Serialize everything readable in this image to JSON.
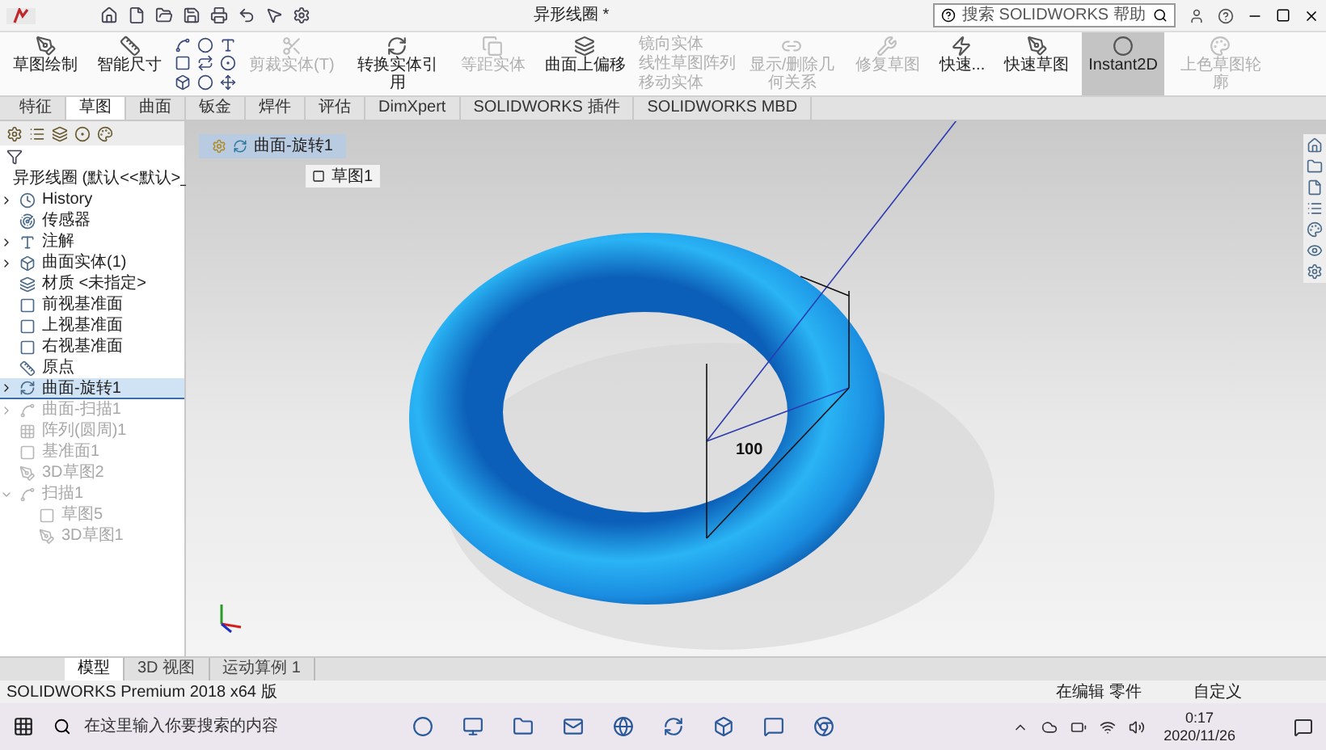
{
  "window": {
    "title": "异形线圈 *",
    "search": {
      "placeholder": "搜索 SOLIDWORKS 帮助"
    }
  },
  "ribbon": [
    {
      "kind": "large",
      "label": "草图绘制",
      "selected": false,
      "disabled": false
    },
    {
      "kind": "large",
      "label": "智能尺寸",
      "selected": false,
      "disabled": false
    },
    {
      "kind": "tools"
    },
    {
      "kind": "large",
      "label": "剪裁实体(T)",
      "selected": false,
      "disabled": true
    },
    {
      "kind": "large",
      "label": "转换实体引用",
      "selected": false,
      "disabled": false
    },
    {
      "kind": "large",
      "label": "等距实体",
      "selected": false,
      "disabled": true
    },
    {
      "kind": "large",
      "label": "曲面上偏移",
      "selected": false,
      "disabled": false
    },
    {
      "kind": "list",
      "items": [
        {
          "label": "镜向实体",
          "disabled": true
        },
        {
          "label": "线性草图阵列",
          "disabled": true
        },
        {
          "label": "移动实体",
          "disabled": true
        }
      ]
    },
    {
      "kind": "large",
      "label": "显示/删除几何关系",
      "selected": false,
      "disabled": true
    },
    {
      "kind": "large",
      "label": "修复草图",
      "selected": false,
      "disabled": true
    },
    {
      "kind": "large",
      "label": "快速...",
      "selected": false,
      "disabled": false
    },
    {
      "kind": "large",
      "label": "快速草图",
      "selected": false,
      "disabled": false
    },
    {
      "kind": "large",
      "label": "Instant2D",
      "selected": true,
      "disabled": false
    },
    {
      "kind": "large",
      "label": "上色草图轮廓",
      "selected": false,
      "disabled": true
    }
  ],
  "tabs": [
    {
      "label": "特征",
      "selected": false
    },
    {
      "label": "草图",
      "selected": true
    },
    {
      "label": "曲面",
      "selected": false
    },
    {
      "label": "钣金",
      "selected": false
    },
    {
      "label": "焊件",
      "selected": false
    },
    {
      "label": "评估",
      "selected": false
    },
    {
      "label": "DimXpert",
      "selected": false
    },
    {
      "label": "SOLIDWORKS 插件",
      "selected": false
    },
    {
      "label": "SOLIDWORKS MBD",
      "selected": false
    }
  ],
  "tree": {
    "root": "异形线圈 (默认<<默认>_",
    "items": [
      {
        "kind": "history",
        "label": "History",
        "expanded": false,
        "selected": false,
        "disabled": false
      },
      {
        "kind": "sensor",
        "label": "传感器",
        "selected": false,
        "disabled": false
      },
      {
        "kind": "annotation",
        "label": "注解",
        "expanded": false,
        "selected": false,
        "disabled": false
      },
      {
        "kind": "body",
        "label": "曲面实体(1)",
        "expanded": false,
        "selected": false,
        "disabled": false
      },
      {
        "kind": "material",
        "label": "材质 <未指定>",
        "selected": false,
        "disabled": false
      },
      {
        "kind": "plane",
        "label": "前视基准面",
        "selected": false,
        "disabled": false
      },
      {
        "kind": "plane",
        "label": "上视基准面",
        "selected": false,
        "disabled": false
      },
      {
        "kind": "plane",
        "label": "右视基准面",
        "selected": false,
        "disabled": false
      },
      {
        "kind": "origin",
        "label": "原点",
        "selected": false,
        "disabled": false
      },
      {
        "kind": "revolve",
        "label": "曲面-旋转1",
        "expanded": false,
        "selected": true,
        "disabled": false
      },
      {
        "kind": "sweep",
        "label": "曲面-扫描1",
        "expanded": false,
        "selected": false,
        "disabled": true
      },
      {
        "kind": "pattern",
        "label": "阵列(圆周)1",
        "selected": false,
        "disabled": true
      },
      {
        "kind": "plane",
        "label": "基准面1",
        "selected": false,
        "disabled": true
      },
      {
        "kind": "sketch3d",
        "label": "3D草图2",
        "selected": false,
        "disabled": true
      },
      {
        "kind": "sweep",
        "label": "扫描1",
        "expanded": true,
        "selected": false,
        "disabled": true,
        "children": [
          {
            "kind": "sketch",
            "label": "草图5",
            "selected": false,
            "disabled": true
          },
          {
            "kind": "sketch3d",
            "label": "3D草图1",
            "selected": false,
            "disabled": true
          }
        ]
      }
    ]
  },
  "viewport": {
    "breadcrumb": "曲面-旋转1",
    "breadcrumb_child": "草图1",
    "dimension": "100"
  },
  "bottom_tabs": [
    {
      "label": "模型",
      "selected": true
    },
    {
      "label": "3D 视图",
      "selected": false
    },
    {
      "label": "运动算例 1",
      "selected": false
    }
  ],
  "status_bar": {
    "product": "SOLIDWORKS Premium 2018 x64 版",
    "mode": "在编辑 零件",
    "units": "自定义"
  },
  "taskbar": {
    "search": {
      "placeholder": "在这里输入你要搜索的内容"
    },
    "time": "0:17",
    "date": "2020/11/26"
  }
}
